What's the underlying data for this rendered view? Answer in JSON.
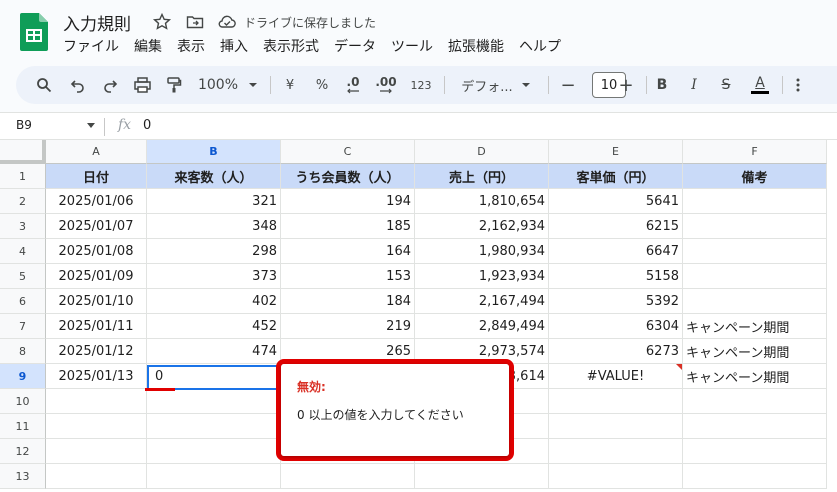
{
  "app": {
    "doc_title": "入力規則",
    "save_status": "ドライブに保存しました",
    "menu": [
      "ファイル",
      "編集",
      "表示",
      "挿入",
      "表示形式",
      "データ",
      "ツール",
      "拡張機能",
      "ヘルプ"
    ]
  },
  "toolbar": {
    "zoom": "100%",
    "currency": "¥",
    "percent": "%",
    "dec_decrease": ".0",
    "dec_increase": ".00",
    "number_format": "123",
    "font": "デフォ...",
    "font_size": "10",
    "minus": "−",
    "plus": "+",
    "bold": "B",
    "italic": "I",
    "strike": "S",
    "text_color": "A"
  },
  "formula_bar": {
    "cell_ref": "B9",
    "fx": "fx",
    "value": "0"
  },
  "columns": [
    "A",
    "B",
    "C",
    "D",
    "E",
    "F"
  ],
  "rows": [
    "1",
    "2",
    "3",
    "4",
    "5",
    "6",
    "7",
    "8",
    "9",
    "10",
    "11",
    "12",
    "13"
  ],
  "table": {
    "headers": [
      "日付",
      "来客数（人）",
      "うち会員数（人）",
      "売上（円）",
      "客単価（円）",
      "備考"
    ],
    "data": [
      [
        "2025/01/06",
        "321",
        "194",
        "1,810,654",
        "5641",
        ""
      ],
      [
        "2025/01/07",
        "348",
        "185",
        "2,162,934",
        "6215",
        ""
      ],
      [
        "2025/01/08",
        "298",
        "164",
        "1,980,934",
        "6647",
        ""
      ],
      [
        "2025/01/09",
        "373",
        "153",
        "1,923,934",
        "5158",
        ""
      ],
      [
        "2025/01/10",
        "402",
        "184",
        "2,167,494",
        "5392",
        ""
      ],
      [
        "2025/01/11",
        "452",
        "219",
        "2,849,494",
        "6304",
        "キャンペーン期間"
      ],
      [
        "2025/01/12",
        "474",
        "265",
        "2,973,574",
        "6273",
        "キャンペーン期間"
      ],
      [
        "2025/01/13",
        "0",
        "",
        "3,614",
        "#VALUE!",
        "キャンペーン期間"
      ]
    ]
  },
  "validation_popup": {
    "title": "無効:",
    "message": "0 以上の値を入力してください"
  },
  "colors": {
    "header_fill": "#c9daf8",
    "selection": "#1a73e8",
    "error": "#d93025",
    "highlight_frame": "#e00000"
  }
}
